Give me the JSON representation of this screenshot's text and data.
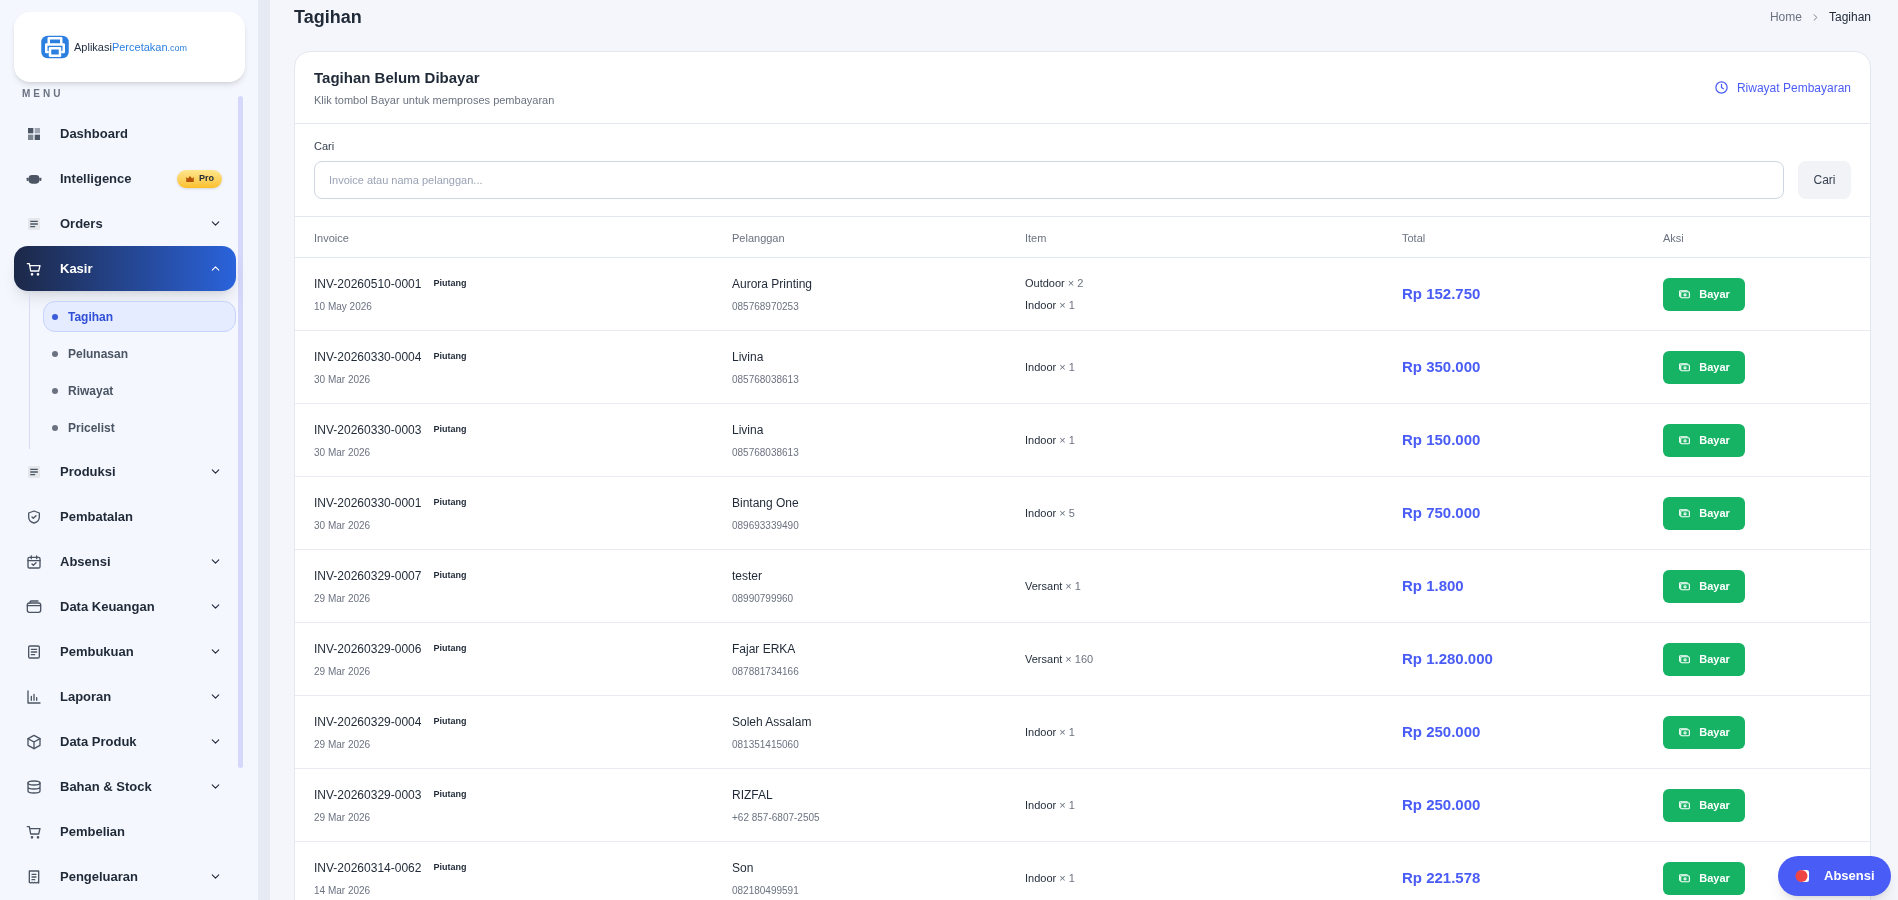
{
  "sidebar": {
    "logo": {
      "text_1": "Aplikasi",
      "text_2": "Percetakan",
      ".com": ".com"
    },
    "section_label": "MENU",
    "items": [
      {
        "label": "Dashboard",
        "kind": "link",
        "selected": false
      },
      {
        "label": "Intelligence",
        "kind": "link",
        "selected": false,
        "badge": "Pro"
      },
      {
        "label": "Orders",
        "kind": "group",
        "expanded": false,
        "selected": false
      },
      {
        "label": "Kasir",
        "kind": "group",
        "expanded": true,
        "selected": true,
        "children": [
          {
            "label": "Tagihan",
            "selected": true
          },
          {
            "label": "Pelunasan",
            "selected": false
          },
          {
            "label": "Riwayat",
            "selected": false
          },
          {
            "label": "Pricelist",
            "selected": false
          }
        ]
      },
      {
        "label": "Produksi",
        "kind": "group",
        "expanded": false,
        "selected": false
      },
      {
        "label": "Pembatalan",
        "kind": "link",
        "selected": false
      },
      {
        "label": "Absensi",
        "kind": "group",
        "expanded": false,
        "selected": false
      },
      {
        "label": "Data Keuangan",
        "kind": "group",
        "expanded": false,
        "selected": false
      },
      {
        "label": "Pembukuan",
        "kind": "group",
        "expanded": false,
        "selected": false
      },
      {
        "label": "Laporan",
        "kind": "group",
        "expanded": false,
        "selected": false
      },
      {
        "label": "Data Produk",
        "kind": "group",
        "expanded": false,
        "selected": false
      },
      {
        "label": "Bahan & Stock",
        "kind": "group",
        "expanded": false,
        "selected": false
      },
      {
        "label": "Pembelian",
        "kind": "link",
        "selected": false
      },
      {
        "label": "Pengeluaran",
        "kind": "group",
        "expanded": false,
        "selected": false
      }
    ]
  },
  "page": {
    "title": "Tagihan",
    "breadcrumb": [
      "Home",
      "Tagihan"
    ]
  },
  "card": {
    "title": "Tagihan Belum Dibayar",
    "subtitle": "Klik tombol Bayar untuk memproses pembayaran",
    "history_link": "Riwayat Pembayaran",
    "search": {
      "label": "Cari",
      "placeholder": "Invoice atau nama pelanggan...",
      "button": "Cari"
    },
    "table": {
      "columns": [
        "Invoice",
        "Pelanggan",
        "Item",
        "Total",
        "Aksi"
      ],
      "rows": [
        {
          "invoice": "INV-20260510-0001",
          "status": "Piutang",
          "date": "10 May 2026",
          "customer": "Aurora Printing",
          "phone": "085768970253",
          "items": [
            {
              "name": "Outdoor",
              "qty": "× 2"
            },
            {
              "name": "Indoor",
              "qty": "× 1"
            }
          ],
          "total": "Rp 152.750",
          "action": "Bayar"
        },
        {
          "invoice": "INV-20260330-0004",
          "status": "Piutang",
          "date": "30 Mar 2026",
          "customer": "Livina",
          "phone": "085768038613",
          "items": [
            {
              "name": "Indoor",
              "qty": "× 1"
            }
          ],
          "total": "Rp 350.000",
          "action": "Bayar"
        },
        {
          "invoice": "INV-20260330-0003",
          "status": "Piutang",
          "date": "30 Mar 2026",
          "customer": "Livina",
          "phone": "085768038613",
          "items": [
            {
              "name": "Indoor",
              "qty": "× 1"
            }
          ],
          "total": "Rp 150.000",
          "action": "Bayar"
        },
        {
          "invoice": "INV-20260330-0001",
          "status": "Piutang",
          "date": "30 Mar 2026",
          "customer": "Bintang One",
          "phone": "089693339490",
          "items": [
            {
              "name": "Indoor",
              "qty": "× 5"
            }
          ],
          "total": "Rp 750.000",
          "action": "Bayar"
        },
        {
          "invoice": "INV-20260329-0007",
          "status": "Piutang",
          "date": "29 Mar 2026",
          "customer": "tester",
          "phone": "08990799960",
          "items": [
            {
              "name": "Versant",
              "qty": "× 1"
            }
          ],
          "total": "Rp 1.800",
          "action": "Bayar"
        },
        {
          "invoice": "INV-20260329-0006",
          "status": "Piutang",
          "date": "29 Mar 2026",
          "customer": "Fajar ERKA",
          "phone": "087881734166",
          "items": [
            {
              "name": "Versant",
              "qty": "× 160"
            }
          ],
          "total": "Rp 1.280.000",
          "action": "Bayar"
        },
        {
          "invoice": "INV-20260329-0004",
          "status": "Piutang",
          "date": "29 Mar 2026",
          "customer": "Soleh Assalam",
          "phone": "081351415060",
          "items": [
            {
              "name": "Indoor",
              "qty": "× 1"
            }
          ],
          "total": "Rp 250.000",
          "action": "Bayar"
        },
        {
          "invoice": "INV-20260329-0003",
          "status": "Piutang",
          "date": "29 Mar 2026",
          "customer": "RIZFAL",
          "phone": "+62 857-6807-2505",
          "items": [
            {
              "name": "Indoor",
              "qty": "× 1"
            }
          ],
          "total": "Rp 250.000",
          "action": "Bayar"
        },
        {
          "invoice": "INV-20260314-0062",
          "status": "Piutang",
          "date": "14 Mar 2026",
          "customer": "Son",
          "phone": "082180499591",
          "items": [
            {
              "name": "Indoor",
              "qty": "× 1"
            }
          ],
          "total": "Rp 221.578",
          "action": "Bayar"
        }
      ]
    }
  },
  "floating_button": {
    "label": "Absensi"
  }
}
